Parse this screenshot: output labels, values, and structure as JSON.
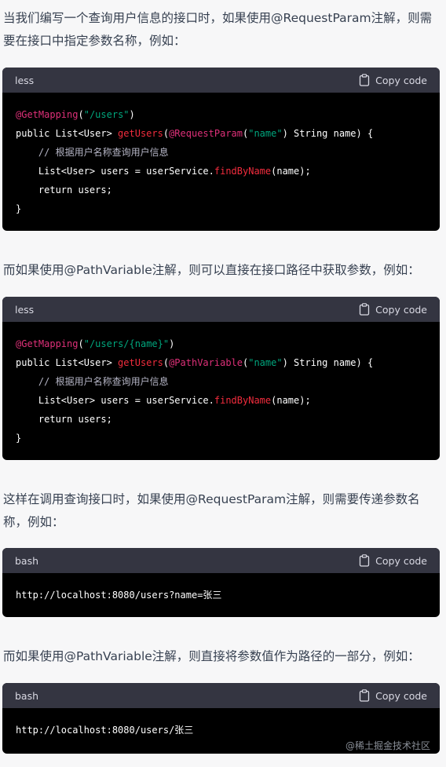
{
  "copy_label": "Copy code",
  "paragraphs": {
    "p1": "当我们编写一个查询用户信息的接口时，如果使用@RequestParam注解，则需要在接口中指定参数名称，例如：",
    "p2": "而如果使用@PathVariable注解，则可以直接在接口路径中获取参数，例如：",
    "p3": "这样在调用查询接口时，如果使用@RequestParam注解，则需要传递参数名称，例如：",
    "p4": "而如果使用@PathVariable注解，则直接将参数值作为路径的一部分，例如："
  },
  "blocks": [
    {
      "language": "less",
      "lines": [
        [
          {
            "t": "@GetMapping",
            "c": "anno"
          },
          {
            "t": "(",
            "c": "plain"
          },
          {
            "t": "\"/users\"",
            "c": "str"
          },
          {
            "t": ")",
            "c": "plain"
          }
        ],
        [
          {
            "t": "public List<User> ",
            "c": "plain"
          },
          {
            "t": "getUsers",
            "c": "fn"
          },
          {
            "t": "(",
            "c": "plain"
          },
          {
            "t": "@RequestParam",
            "c": "anno"
          },
          {
            "t": "(",
            "c": "plain"
          },
          {
            "t": "\"name\"",
            "c": "str"
          },
          {
            "t": ") String name) {",
            "c": "plain"
          }
        ],
        [
          {
            "t": "    // 根据用户名称查询用户信息",
            "c": "cm"
          }
        ],
        [
          {
            "t": "    List<User> users = userService.",
            "c": "plain"
          },
          {
            "t": "findByName",
            "c": "fn"
          },
          {
            "t": "(name);",
            "c": "plain"
          }
        ],
        [
          {
            "t": "    return users;",
            "c": "plain"
          }
        ],
        [
          {
            "t": "}",
            "c": "plain"
          }
        ]
      ]
    },
    {
      "language": "less",
      "lines": [
        [
          {
            "t": "@GetMapping",
            "c": "anno"
          },
          {
            "t": "(",
            "c": "plain"
          },
          {
            "t": "\"/users/{name}\"",
            "c": "str"
          },
          {
            "t": ")",
            "c": "plain"
          }
        ],
        [
          {
            "t": "public List<User> ",
            "c": "plain"
          },
          {
            "t": "getUsers",
            "c": "fn"
          },
          {
            "t": "(",
            "c": "plain"
          },
          {
            "t": "@PathVariable",
            "c": "anno"
          },
          {
            "t": "(",
            "c": "plain"
          },
          {
            "t": "\"name\"",
            "c": "str"
          },
          {
            "t": ") String name) {",
            "c": "plain"
          }
        ],
        [
          {
            "t": "    // 根据用户名称查询用户信息",
            "c": "cm"
          }
        ],
        [
          {
            "t": "    List<User> users = userService.",
            "c": "plain"
          },
          {
            "t": "findByName",
            "c": "fn"
          },
          {
            "t": "(name);",
            "c": "plain"
          }
        ],
        [
          {
            "t": "    return users;",
            "c": "plain"
          }
        ],
        [
          {
            "t": "}",
            "c": "plain"
          }
        ]
      ]
    },
    {
      "language": "bash",
      "lines": [
        [
          {
            "t": "http://localhost:8080/users?name=张三",
            "c": "plain"
          }
        ]
      ]
    },
    {
      "language": "bash",
      "lines": [
        [
          {
            "t": "http://localhost:8080/users/张三",
            "c": "plain"
          }
        ]
      ]
    }
  ],
  "watermark": "@稀土掘金技术社区"
}
